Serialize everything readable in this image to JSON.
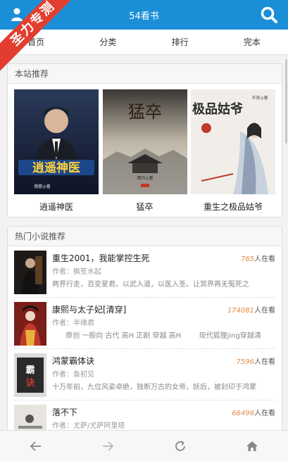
{
  "header": {
    "title": "54看书",
    "ribbon_text": "圣力专测"
  },
  "nav": {
    "tabs": [
      "首页",
      "分类",
      "排行",
      "完本"
    ]
  },
  "recommend": {
    "heading": "本站推荐",
    "books": [
      {
        "name": "逍遥神医",
        "cover_text": "逍遥神医",
        "cover_author": "傲鹏◎著"
      },
      {
        "name": "猛卒",
        "cover_text": "猛卒",
        "cover_author": "鹰玛◎著"
      },
      {
        "name": "重生之极品姑爷",
        "cover_text": "极品姑爷",
        "cover_author": "半夜◎著"
      }
    ]
  },
  "hot": {
    "heading": "热门小说推荐",
    "readers_suffix": "人在看",
    "author_prefix": "作者：",
    "books": [
      {
        "title": "重生2001，我能掌控生死",
        "readers": "765",
        "author": "枫笙水起",
        "desc": "两界行走，百变星君。以武入道，以医入圣。让冥界再无冤死之"
      },
      {
        "title": "康熙与太子妃[清穿]",
        "readers": "174081",
        "author": "半缘君",
        "desc": "      原创 一般向 古代 高H 正剧 穿越 高H        现代狐狸jing穿越清"
      },
      {
        "title": "鸿蒙霸体诀",
        "readers": "7596",
        "author": "鱼初见",
        "desc": "十万年前，九位风姿卓绝，独断万古的女帝，妖后，被封印于鸿蒙"
      },
      {
        "title": "落不下",
        "readers": "66496",
        "author": "尤萨/尤萨阿里塔",
        "desc": ""
      }
    ]
  },
  "colors": {
    "brand": "#1a8fd8",
    "ribbon": "#e23e30",
    "readers_number": "#e38a45"
  },
  "bottom_bar": {
    "icons": [
      "back-arrow-icon",
      "forward-arrow-icon",
      "refresh-icon",
      "home-icon"
    ]
  }
}
